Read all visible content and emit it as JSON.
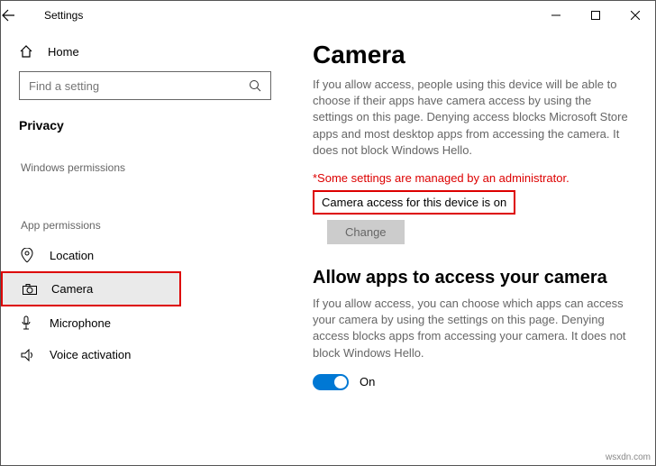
{
  "window": {
    "title": "Settings"
  },
  "sidebar": {
    "home_label": "Home",
    "search_placeholder": "Find a setting",
    "category": "Privacy",
    "section_win": "Windows permissions",
    "section_app": "App permissions",
    "items": {
      "location": "Location",
      "camera": "Camera",
      "microphone": "Microphone",
      "voice": "Voice activation"
    }
  },
  "content": {
    "heading": "Camera",
    "description": "If you allow access, people using this device will be able to choose if their apps have camera access by using the settings on this page. Denying access blocks Microsoft Store apps and most desktop apps from accessing the camera. It does not block Windows Hello.",
    "admin_note": "*Some settings are managed by an administrator.",
    "device_status": "Camera access for this device is on",
    "change_label": "Change",
    "apps_heading": "Allow apps to access your camera",
    "apps_description": "If you allow access, you can choose which apps can access your camera by using the settings on this page. Denying access blocks apps from accessing your camera. It does not block Windows Hello.",
    "toggle_label": "On"
  },
  "attribution": "wsxdn.com"
}
